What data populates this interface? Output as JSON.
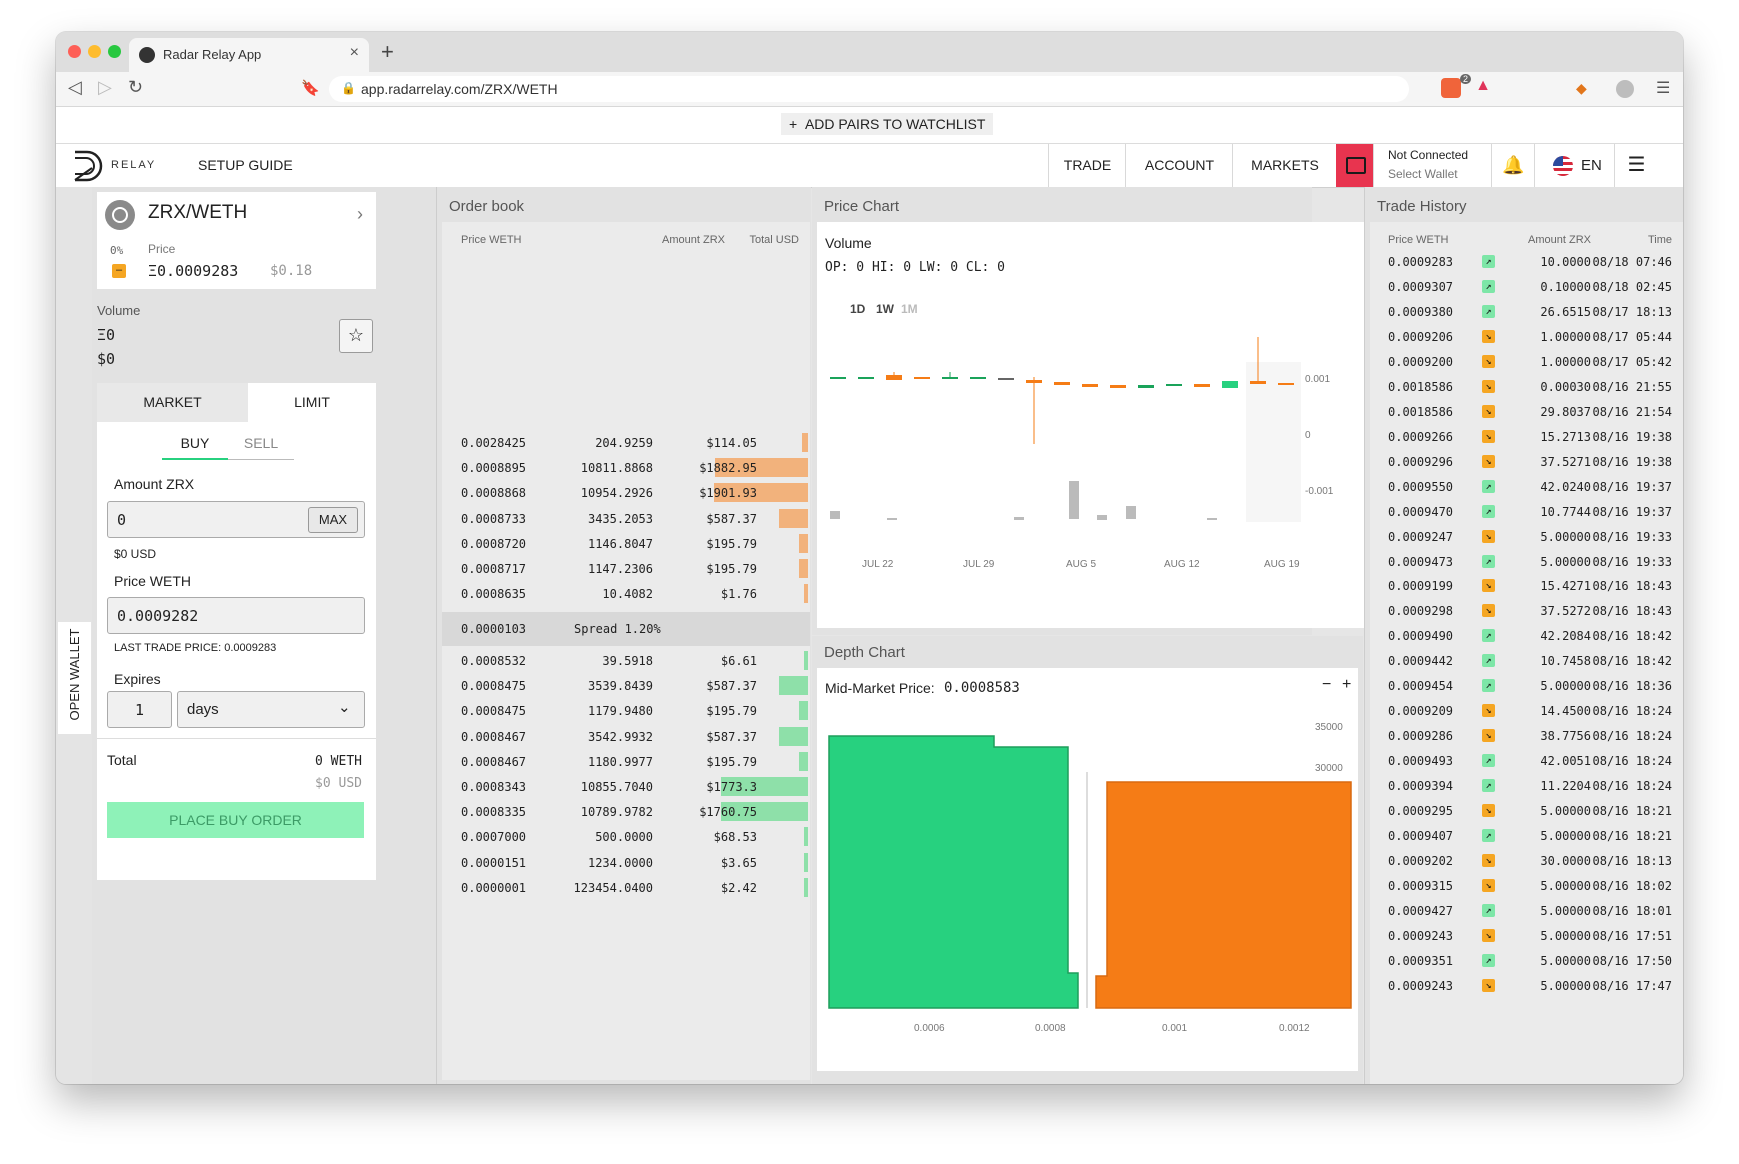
{
  "browser": {
    "tab_title": "Radar Relay App",
    "url": "app.radarrelay.com/ZRX/WETH",
    "shield_badge": "2"
  },
  "watchlist": {
    "label": "ADD PAIRS TO WATCHLIST",
    "plus": "+"
  },
  "header": {
    "logo_text": "RELAY",
    "setup_guide": "SETUP GUIDE",
    "nav": [
      "TRADE",
      "ACCOUNT",
      "MARKETS"
    ],
    "wallet_status": "Not Connected",
    "wallet_action": "Select Wallet",
    "language": "EN"
  },
  "side_tab": "OPEN WALLET",
  "pair": {
    "name": "ZRX/WETH",
    "change": "0%",
    "price_label": "Price",
    "price_weth": "Ξ0.0009283",
    "price_usd": "$0.18",
    "volume_label": "Volume",
    "volume_weth": "Ξ0",
    "volume_usd": "$0"
  },
  "order_form": {
    "tabs": [
      "MARKET",
      "LIMIT"
    ],
    "sides": [
      "BUY",
      "SELL"
    ],
    "amount_label": "Amount ZRX",
    "amount_value": "0",
    "max_label": "MAX",
    "amount_usd": "$0 USD",
    "price_label": "Price WETH",
    "price_value": "0.0009282",
    "last_trade": "LAST TRADE PRICE: 0.0009283",
    "expires_label": "Expires",
    "expires_value": "1",
    "expires_unit": "days",
    "total_label": "Total",
    "total_weth": "0 WETH",
    "total_usd": "$0 USD",
    "submit": "PLACE BUY ORDER"
  },
  "order_book": {
    "title": "Order book",
    "columns": [
      "Price WETH",
      "Amount ZRX",
      "Total USD"
    ],
    "asks": [
      {
        "price": "0.0028425",
        "amount": "204.9259",
        "total": "$114.05",
        "depth": 0.06
      },
      {
        "price": "0.0008895",
        "amount": "10811.8868",
        "total": "$1882.95",
        "depth": 0.99
      },
      {
        "price": "0.0008868",
        "amount": "10954.2926",
        "total": "$1901.93",
        "depth": 1.0
      },
      {
        "price": "0.0008733",
        "amount": "3435.2053",
        "total": "$587.37",
        "depth": 0.31
      },
      {
        "price": "0.0008720",
        "amount": "1146.8047",
        "total": "$195.79",
        "depth": 0.1
      },
      {
        "price": "0.0008717",
        "amount": "1147.2306",
        "total": "$195.79",
        "depth": 0.1
      },
      {
        "price": "0.0008635",
        "amount": "10.4082",
        "total": "$1.76",
        "depth": 0.01
      }
    ],
    "spread_price": "0.0000103",
    "spread_label": "Spread 1.20%",
    "bids": [
      {
        "price": "0.0008532",
        "amount": "39.5918",
        "total": "$6.61",
        "depth": 0.01
      },
      {
        "price": "0.0008475",
        "amount": "3539.8439",
        "total": "$587.37",
        "depth": 0.31
      },
      {
        "price": "0.0008475",
        "amount": "1179.9480",
        "total": "$195.79",
        "depth": 0.1
      },
      {
        "price": "0.0008467",
        "amount": "3542.9932",
        "total": "$587.37",
        "depth": 0.31
      },
      {
        "price": "0.0008467",
        "amount": "1180.9977",
        "total": "$195.79",
        "depth": 0.1
      },
      {
        "price": "0.0008343",
        "amount": "10855.7040",
        "total": "$1773.3",
        "depth": 0.93
      },
      {
        "price": "0.0008335",
        "amount": "10789.9782",
        "total": "$1760.75",
        "depth": 0.93
      },
      {
        "price": "0.0007000",
        "amount": "500.0000",
        "total": "$68.53",
        "depth": 0.03
      },
      {
        "price": "0.0000151",
        "amount": "1234.0000",
        "total": "$3.65",
        "depth": 0.01
      },
      {
        "price": "0.0000001",
        "amount": "123454.0400",
        "total": "$2.42",
        "depth": 0.01
      }
    ]
  },
  "price_chart": {
    "title": "Price Chart",
    "subtitle": "Volume",
    "ohlc": "OP: 0 HI: 0 LW: 0 CL: 0",
    "ranges": [
      "1D",
      "1W",
      "1M"
    ],
    "x_labels": [
      "JUL 22",
      "JUL 29",
      "AUG 5",
      "AUG 12",
      "AUG 19"
    ],
    "y_labels": [
      "0.001",
      "0",
      "-0.001"
    ]
  },
  "depth_chart": {
    "title": "Depth Chart",
    "mid_label": "Mid-Market Price:",
    "mid_value": "0.0008583",
    "zoom_out": "−",
    "zoom_in": "+",
    "y_labels": [
      "35000",
      "30000"
    ],
    "x_labels": [
      "0.0006",
      "0.0008",
      "0.001",
      "0.0012"
    ]
  },
  "chart_data": [
    {
      "type": "bar",
      "title": "Volume",
      "categories": [
        "JUL 22",
        "JUL 29",
        "AUG 5",
        "AUG 12",
        "AUG 19"
      ],
      "series": [],
      "ylim": [
        -0.001,
        0.001
      ]
    },
    {
      "type": "area",
      "title": "Depth Chart",
      "x_ticks": [
        0.0006,
        0.0008,
        0.001,
        0.0012
      ],
      "y_ticks": [
        30000,
        35000
      ]
    }
  ],
  "trade_history": {
    "title": "Trade History",
    "columns": [
      "Price WETH",
      "Amount ZRX",
      "Time"
    ],
    "rows": [
      {
        "price": "0.0009283",
        "side": "up",
        "amount": "10.0000",
        "time": "08/18 07:46"
      },
      {
        "price": "0.0009307",
        "side": "up",
        "amount": "0.10000",
        "time": "08/18 02:45"
      },
      {
        "price": "0.0009380",
        "side": "up",
        "amount": "26.6515",
        "time": "08/17 18:13"
      },
      {
        "price": "0.0009206",
        "side": "down",
        "amount": "1.00000",
        "time": "08/17 05:44"
      },
      {
        "price": "0.0009200",
        "side": "down",
        "amount": "1.00000",
        "time": "08/17 05:42"
      },
      {
        "price": "0.0018586",
        "side": "down",
        "amount": "0.00030",
        "time": "08/16 21:55"
      },
      {
        "price": "0.0018586",
        "side": "down",
        "amount": "29.8037",
        "time": "08/16 21:54"
      },
      {
        "price": "0.0009266",
        "side": "down",
        "amount": "15.2713",
        "time": "08/16 19:38"
      },
      {
        "price": "0.0009296",
        "side": "down",
        "amount": "37.5271",
        "time": "08/16 19:38"
      },
      {
        "price": "0.0009550",
        "side": "up",
        "amount": "42.0240",
        "time": "08/16 19:37"
      },
      {
        "price": "0.0009470",
        "side": "up",
        "amount": "10.7744",
        "time": "08/16 19:37"
      },
      {
        "price": "0.0009247",
        "side": "down",
        "amount": "5.00000",
        "time": "08/16 19:33"
      },
      {
        "price": "0.0009473",
        "side": "up",
        "amount": "5.00000",
        "time": "08/16 19:33"
      },
      {
        "price": "0.0009199",
        "side": "down",
        "amount": "15.4271",
        "time": "08/16 18:43"
      },
      {
        "price": "0.0009298",
        "side": "down",
        "amount": "37.5272",
        "time": "08/16 18:43"
      },
      {
        "price": "0.0009490",
        "side": "up",
        "amount": "42.2084",
        "time": "08/16 18:42"
      },
      {
        "price": "0.0009442",
        "side": "up",
        "amount": "10.7458",
        "time": "08/16 18:42"
      },
      {
        "price": "0.0009454",
        "side": "up",
        "amount": "5.00000",
        "time": "08/16 18:36"
      },
      {
        "price": "0.0009209",
        "side": "down",
        "amount": "14.4500",
        "time": "08/16 18:24"
      },
      {
        "price": "0.0009286",
        "side": "down",
        "amount": "38.7756",
        "time": "08/16 18:24"
      },
      {
        "price": "0.0009493",
        "side": "up",
        "amount": "42.0051",
        "time": "08/16 18:24"
      },
      {
        "price": "0.0009394",
        "side": "up",
        "amount": "11.2204",
        "time": "08/16 18:24"
      },
      {
        "price": "0.0009295",
        "side": "down",
        "amount": "5.00000",
        "time": "08/16 18:21"
      },
      {
        "price": "0.0009407",
        "side": "up",
        "amount": "5.00000",
        "time": "08/16 18:21"
      },
      {
        "price": "0.0009202",
        "side": "down",
        "amount": "30.0000",
        "time": "08/16 18:13"
      },
      {
        "price": "0.0009315",
        "side": "down",
        "amount": "5.00000",
        "time": "08/16 18:02"
      },
      {
        "price": "0.0009427",
        "side": "up",
        "amount": "5.00000",
        "time": "08/16 18:01"
      },
      {
        "price": "0.0009243",
        "side": "down",
        "amount": "5.00000",
        "time": "08/16 17:51"
      },
      {
        "price": "0.0009351",
        "side": "up",
        "amount": "5.00000",
        "time": "08/16 17:50"
      },
      {
        "price": "0.0009243",
        "side": "down",
        "amount": "5.00000",
        "time": "08/16 17:47"
      }
    ]
  },
  "colors": {
    "buy": "#27d17f",
    "sell": "#f57c16",
    "ask_bar": "#f2b27c",
    "bid_bar": "#8ee0a9",
    "wallet_red": "#e8344f",
    "submit_bg": "#8ef2b8"
  }
}
